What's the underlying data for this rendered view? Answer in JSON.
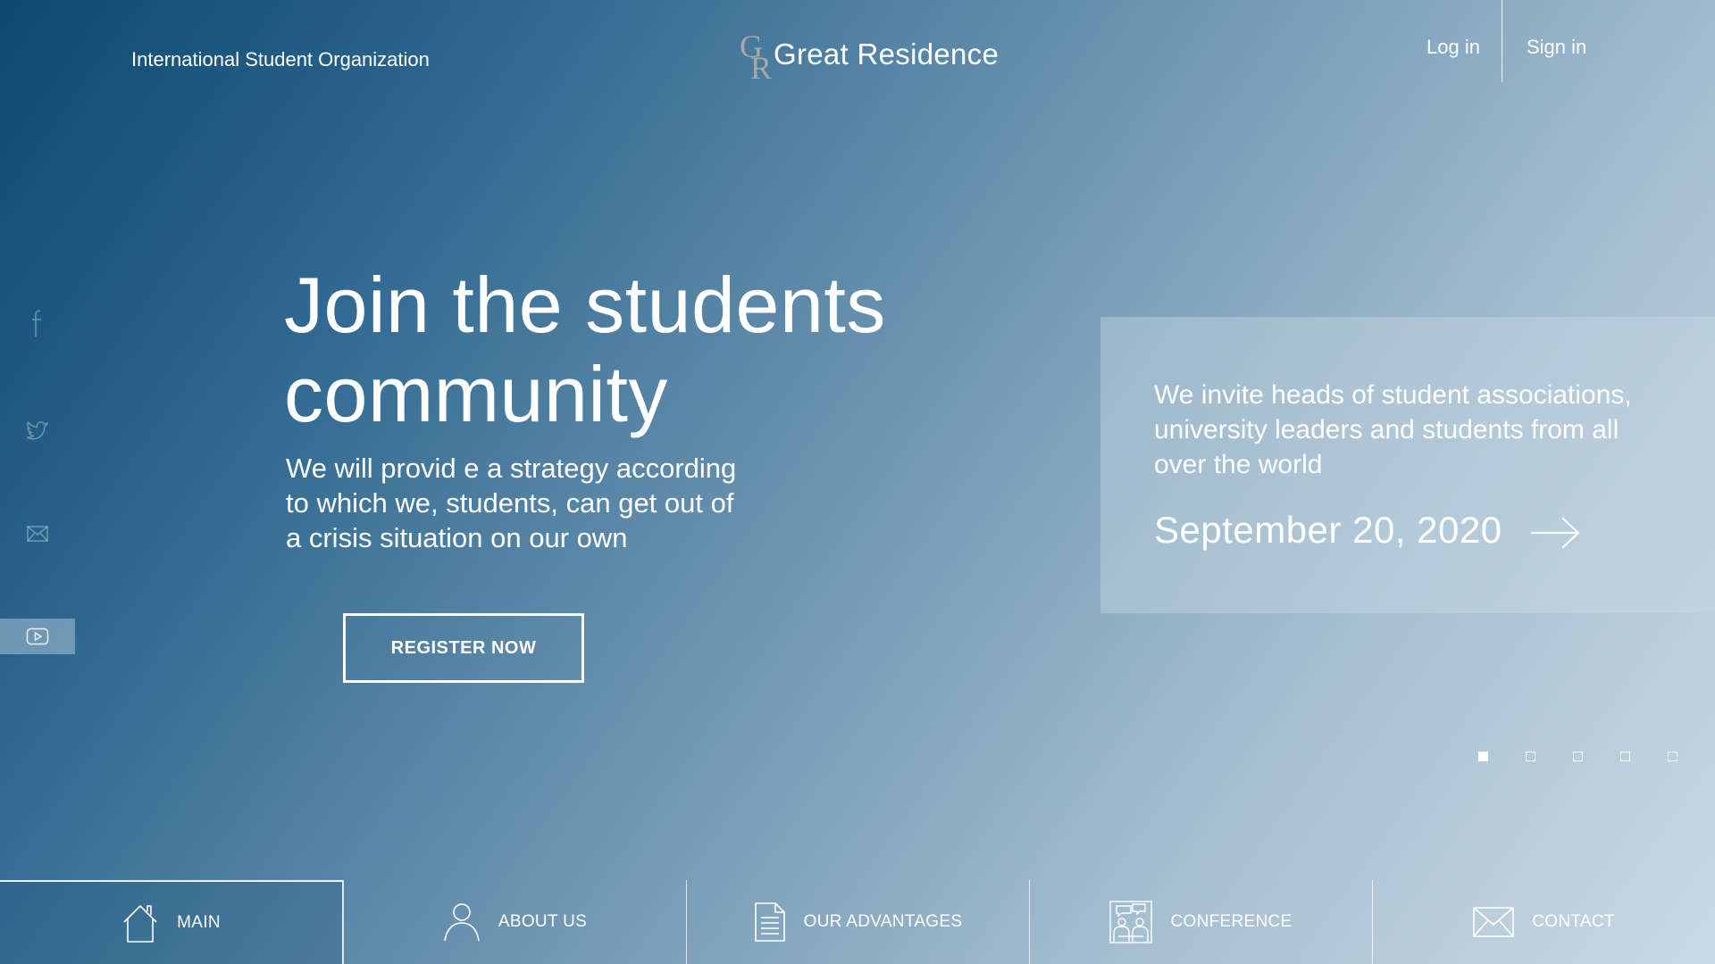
{
  "header": {
    "org_name": "International Student Organization",
    "logo": {
      "letters": [
        "G",
        "R"
      ],
      "text": "Great Residence"
    },
    "login_label": "Log in",
    "signin_label": "Sign in"
  },
  "social": [
    {
      "icon": "facebook-icon"
    },
    {
      "icon": "twitter-icon"
    },
    {
      "icon": "mail-icon"
    },
    {
      "icon": "youtube-icon",
      "active": true
    }
  ],
  "hero": {
    "title_line1": "Join the students",
    "title_line2": "community",
    "subtitle": "We will provid e a strategy according to which we, students, can get out of a crisis situation on our own",
    "cta_label": "REGISTER NOW"
  },
  "invite": {
    "text": "We invite heads of student associations, university leaders and students from all over the world",
    "date": "September 20, 2020",
    "arrow_icon": "arrow-right-icon"
  },
  "slider": {
    "count": 5,
    "active_index": 0
  },
  "bottom_nav": [
    {
      "label": "MAIN",
      "icon": "home-icon",
      "active": true
    },
    {
      "label": "ABOUT US",
      "icon": "user-icon"
    },
    {
      "label": "OUR ADVANTAGES",
      "icon": "document-icon"
    },
    {
      "label": "CONFERENCE",
      "icon": "conference-icon"
    },
    {
      "label": "CONTACT",
      "icon": "envelope-icon"
    }
  ],
  "colors": {
    "gradient_start": "#0c4870",
    "gradient_end": "#cad9e4",
    "text": "#ffffff",
    "logo_letters": "#a9a9a9"
  }
}
